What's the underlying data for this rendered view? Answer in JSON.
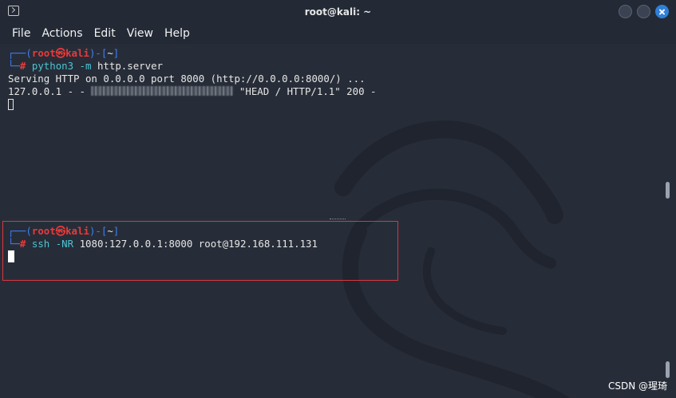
{
  "window": {
    "title": "root@kali: ~"
  },
  "menu": [
    "File",
    "Actions",
    "Edit",
    "View",
    "Help"
  ],
  "prompt": {
    "corner_top": "┌──",
    "corner_bottom": "└─",
    "open": "(",
    "user": "root",
    "sep": "㉿",
    "host": "kali",
    "close": ")-[",
    "dir": "~",
    "end": "]",
    "hash": "#"
  },
  "pane_top": {
    "cmd_name": "python3",
    "cmd_flag": "-m",
    "cmd_args": "http.server",
    "output_line1": "Serving HTTP on 0.0.0.0 port 8000 (http://0.0.0.0:8000/) ...",
    "log_prefix": "127.0.0.1 - - ",
    "log_suffix": " \"HEAD / HTTP/1.1\" 200 -"
  },
  "pane_bottom": {
    "cmd_name": "ssh",
    "cmd_flag": "-NR",
    "cmd_args": "1080:127.0.0.1:8000 root@192.168.111.131"
  },
  "watermark": "CSDN @瑆琦",
  "colors": {
    "prompt_frame": "#3f7ff2",
    "prompt_user": "#ea3a3a",
    "command": "#4dc3d3",
    "highlight_box": "#d9363e",
    "close_button": "#2f7fd9"
  }
}
